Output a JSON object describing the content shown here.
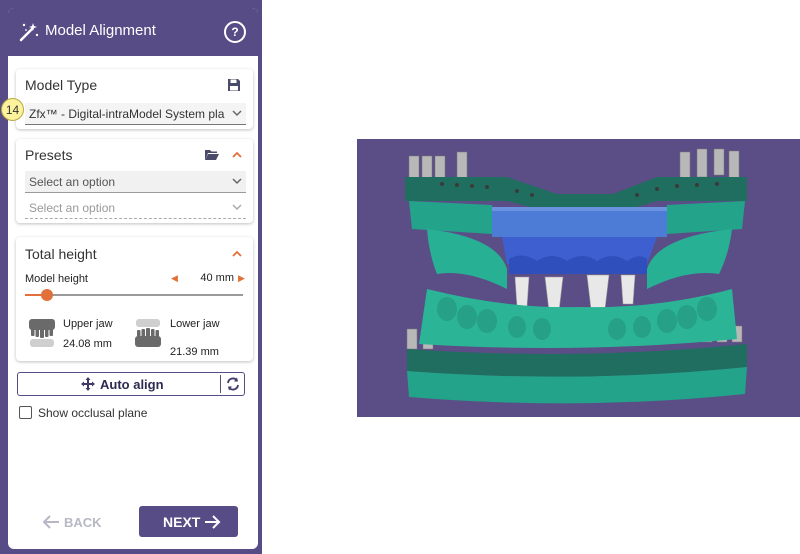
{
  "panel": {
    "title": "Model Alignment",
    "help_glyph": "?"
  },
  "model_type": {
    "title": "Model Type",
    "step_badge": "14",
    "selected": "Zfx™ - Digital-intraModel System pla"
  },
  "presets": {
    "title": "Presets",
    "select1_placeholder": "Select an option",
    "select2_placeholder": "Select an option"
  },
  "total_height": {
    "title": "Total height",
    "model_height_label": "Model height",
    "model_height_value": "40 mm",
    "slider_fraction": 0.1,
    "upper_jaw_label": "Upper jaw",
    "upper_jaw_value": "24.08 mm",
    "lower_jaw_label": "Lower jaw",
    "lower_jaw_value": "21.39 mm"
  },
  "auto_align": {
    "label": "Auto align"
  },
  "occlusal": {
    "label": "Show occlusal plane"
  },
  "footer": {
    "back_label": "BACK",
    "next_label": "NEXT"
  },
  "colors": {
    "brand": "#574c86",
    "accent": "#e2703a",
    "viewport_bg": "#5b4e87",
    "model_base": "#24a88c",
    "tooth_blue": "#4c6fd8"
  },
  "icons": [
    "magic-wand-icon",
    "help-icon",
    "save-icon",
    "folder-open-icon",
    "chevron-up-icon",
    "chevron-down-icon",
    "move-icon",
    "sync-icon",
    "arrow-left-icon",
    "arrow-right-icon",
    "upper-jaw-icon",
    "lower-jaw-icon"
  ]
}
